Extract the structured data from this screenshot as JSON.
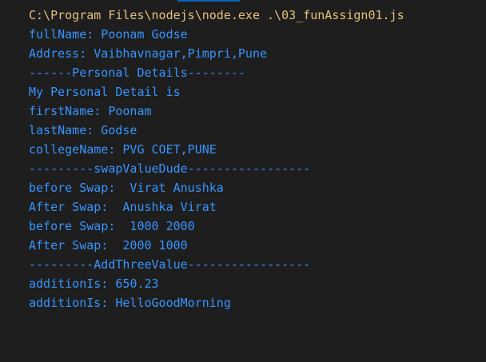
{
  "theme": {
    "background": "#1e1e1e",
    "command_color": "#e5c07b",
    "output_color": "#3794ff",
    "active_tab_indicator": "#0e63b9"
  },
  "terminal": {
    "command": "C:\\Program Files\\nodejs\\node.exe .\\03_funAssign01.js",
    "output_lines": [
      "fullName: Poonam Godse",
      "Address: Vaibhavnagar,Pimpri,Pune",
      "------Personal Details--------",
      "My Personal Detail is",
      "firstName: Poonam",
      "lastName: Godse",
      "collegeName: PVG COET,PUNE",
      "---------swapValueDude-----------------",
      "before Swap:  Virat Anushka",
      "After Swap:  Anushka Virat",
      "before Swap:  1000 2000",
      "After Swap:  2000 1000",
      "---------AddThreeValue-----------------",
      "additionIs: 650.23",
      "additionIs: HelloGoodMorning"
    ]
  }
}
